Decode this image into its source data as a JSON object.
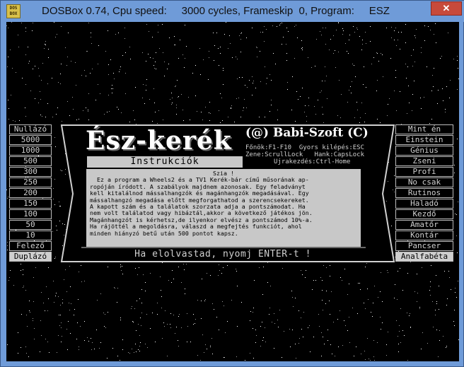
{
  "window": {
    "title": "DOSBox 0.74, Cpu speed:     3000 cycles, Frameskip  0, Program:     ESZ",
    "icon_text": [
      "DOS",
      "BOX"
    ],
    "close_symbol": "✕"
  },
  "game": {
    "logo": "Ész-kerék",
    "copyright": "(@) Babi-Szoft (C)",
    "keys": {
      "line1_left": "Főnök:F1-F10",
      "line1_right": "Gyors kilépés:ESC",
      "line2_left": "Zene:ScrullLock",
      "line2_right": "Hank:CapsLock",
      "line3": "Ujrakezdés:Ctrl-Home"
    },
    "instructions_label": "Instrukciók",
    "textbox": {
      "title": "Szia !",
      "lines": [
        "  Ez a program a Wheels2 és a TV1 Kerék-bár című műsorának ap-",
        "ropóján íródott. A szabályok majdnem azonosak. Egy feladványt",
        "kell kitalálnod mássalhangzók és magánhangzók megadásával. Egy",
        "mássalhangzó megadása előtt megforgathatod a szerencsekereket.",
        "A kapott szám és a találatok szorzata adja a pontszámodat. Ha",
        "nem volt találatod vagy hibáztál,akkor a következő játékos jön.",
        "Magánhangzót is kérhetsz,de ilyenkor elvész a pontszámod 10%-a.",
        "Ha rájöttél a megoldásra, válaszd a megfejtés funkciót, ahol",
        "minden hiányzó betű után 500 pontot kapsz."
      ]
    },
    "bottom_prompt": "Ha elolvastad, nyomj ENTER-t !",
    "left_column": [
      "Nullázó",
      "5000",
      "1000",
      "500",
      "300",
      "250",
      "200",
      "150",
      "100",
      "50",
      "10",
      "Felező",
      "Duplázó"
    ],
    "right_column": [
      "Mint én",
      "Einstein",
      "Génius",
      "Zseni",
      "Profi",
      "No csak",
      "Rutinos",
      "Haladó",
      "Kezdő",
      "Amatőr",
      "Kontár",
      "Pancser",
      "Analfabéta"
    ]
  },
  "colors": {
    "window_frame": "#6f9bd8",
    "close_button": "#c74a3b",
    "dos_gray": "#c8c8c8"
  }
}
